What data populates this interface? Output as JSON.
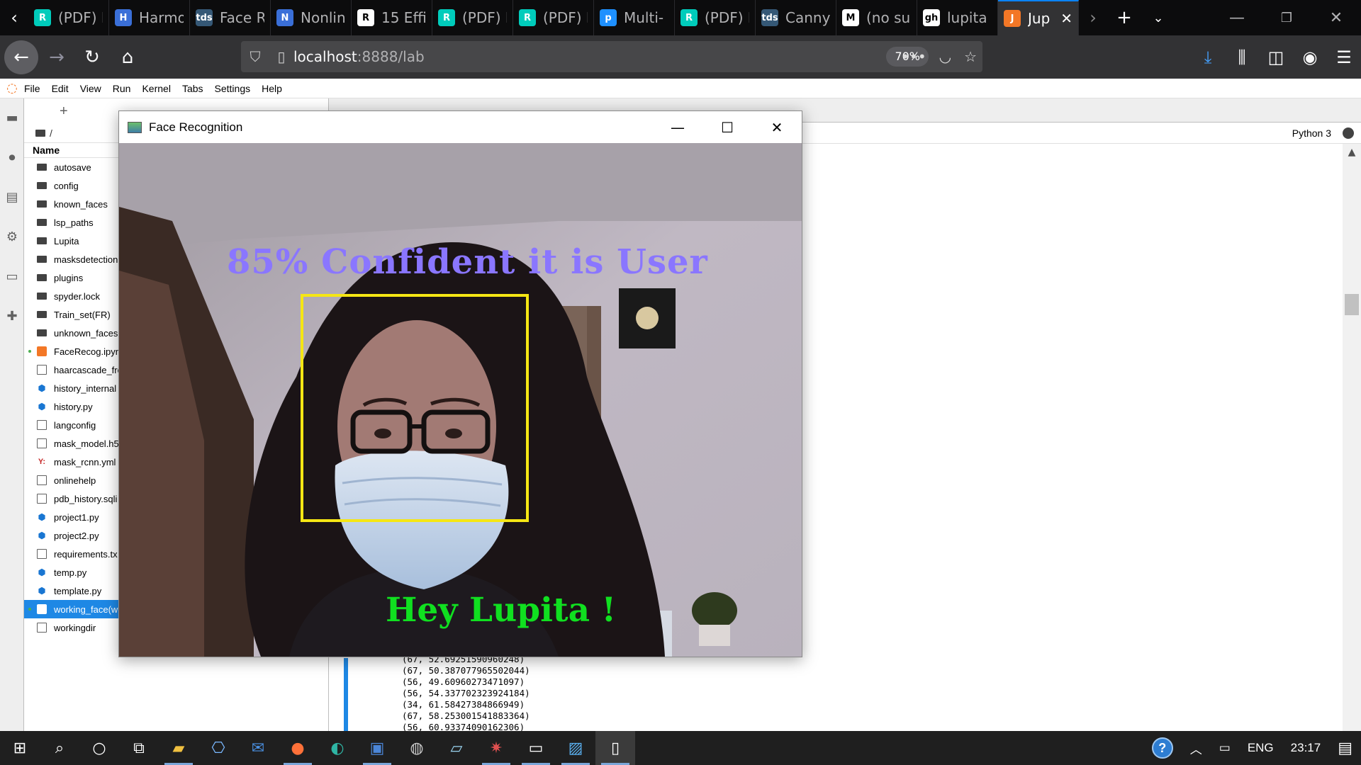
{
  "browser": {
    "tabs": [
      {
        "title": "(PDF) I",
        "favicon": "R",
        "color": "#00ccbb"
      },
      {
        "title": "Harmo",
        "favicon": "H",
        "color": "#3a6fd8"
      },
      {
        "title": "Face R",
        "favicon": "tds",
        "color": "#355876"
      },
      {
        "title": "Nonlin",
        "favicon": "N",
        "color": "#3a6fd8"
      },
      {
        "title": "15 Effi",
        "favicon": "R",
        "color": "#ffffff"
      },
      {
        "title": "(PDF) I",
        "favicon": "R",
        "color": "#00ccbb"
      },
      {
        "title": "(PDF) I",
        "favicon": "R",
        "color": "#00ccbb"
      },
      {
        "title": "Multi-",
        "favicon": "p",
        "color": "#1e90ff"
      },
      {
        "title": "(PDF) I",
        "favicon": "R",
        "color": "#00ccbb"
      },
      {
        "title": "Canny",
        "favicon": "tds",
        "color": "#355876"
      },
      {
        "title": "(no su",
        "favicon": "M",
        "color": "#ffffff"
      },
      {
        "title": "lupita",
        "favicon": "gh",
        "color": "#ffffff"
      },
      {
        "title": "Jup",
        "favicon": "J",
        "color": "#f37726"
      }
    ],
    "url_host": "localhost",
    "url_path": ":8888/lab",
    "zoom": "70%"
  },
  "jupyter": {
    "menu": [
      "File",
      "Edit",
      "View",
      "Run",
      "Kernel",
      "Tabs",
      "Settings",
      "Help"
    ],
    "breadcrumb": "/",
    "column_name": "Name",
    "kernel_name": "Python 3",
    "files": [
      {
        "name": "autosave",
        "type": "folder"
      },
      {
        "name": "config",
        "type": "folder"
      },
      {
        "name": "known_faces",
        "type": "folder"
      },
      {
        "name": "lsp_paths",
        "type": "folder"
      },
      {
        "name": "Lupita",
        "type": "folder"
      },
      {
        "name": "masksdetection",
        "type": "folder"
      },
      {
        "name": "plugins",
        "type": "folder"
      },
      {
        "name": "spyder.lock",
        "type": "folder"
      },
      {
        "name": "Train_set(FR)",
        "type": "folder"
      },
      {
        "name": "unknown_faces",
        "type": "folder"
      },
      {
        "name": "FaceRecog.ipynb",
        "type": "notebook"
      },
      {
        "name": "haarcascade_fro",
        "type": "file"
      },
      {
        "name": "history_internal",
        "type": "python"
      },
      {
        "name": "history.py",
        "type": "python"
      },
      {
        "name": "langconfig",
        "type": "file"
      },
      {
        "name": "mask_model.h5",
        "type": "file"
      },
      {
        "name": "mask_rcnn.yml",
        "type": "yaml"
      },
      {
        "name": "onlinehelp",
        "type": "file"
      },
      {
        "name": "pdb_history.sqli",
        "type": "file"
      },
      {
        "name": "project1.py",
        "type": "python"
      },
      {
        "name": "project2.py",
        "type": "python"
      },
      {
        "name": "requirements.tx",
        "type": "file"
      },
      {
        "name": "temp.py",
        "type": "python"
      },
      {
        "name": "template.py",
        "type": "python"
      },
      {
        "name": "working_face(w",
        "type": "notebook-selected"
      },
      {
        "name": "workingdir",
        "type": "file"
      }
    ],
    "output_lines": [
      "(67, 52.69251590960248)",
      "(67, 50.387077965502044)",
      "(56, 49.60960273471097)",
      "(56, 54.337702323924184)",
      "(34, 61.58427384866949)",
      "(67, 58.253001541883364)",
      "(56, 60.93374090162306)"
    ]
  },
  "face_window": {
    "title": "Face Recognition",
    "confidence_text": "85% Confident it is User",
    "greeting_text": "Hey Lupita !"
  },
  "taskbar": {
    "language": "ENG",
    "time": "23:17"
  }
}
